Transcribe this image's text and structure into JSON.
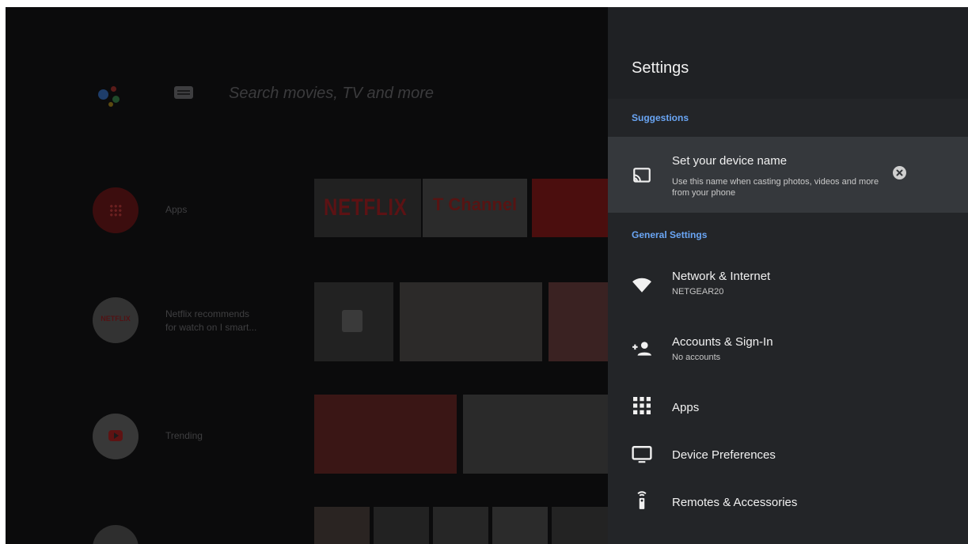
{
  "home": {
    "search_placeholder": "Search movies, TV and more",
    "rows": [
      {
        "label": "Apps"
      },
      {
        "label": "Netflix recommends",
        "label2": "for watch on I smart..."
      },
      {
        "label": "Trending"
      }
    ],
    "netflix_tile": "NETFLIX",
    "channel_tile": "T Channel",
    "netflix_badge": "NETFLIX"
  },
  "settings": {
    "title": "Settings",
    "suggestions_label": "Suggestions",
    "suggestion": {
      "title": "Set your device name",
      "subtitle": "Use this name when casting photos, videos and more from your phone",
      "icon": "cast-icon"
    },
    "general_label": "General Settings",
    "items": [
      {
        "title": "Network & Internet",
        "subtitle": "NETGEAR20",
        "icon": "wifi-icon"
      },
      {
        "title": "Accounts & Sign-In",
        "subtitle": "No accounts",
        "icon": "add-person-icon"
      },
      {
        "title": "Apps",
        "subtitle": "",
        "icon": "apps-grid-icon"
      },
      {
        "title": "Device Preferences",
        "subtitle": "",
        "icon": "tv-icon"
      },
      {
        "title": "Remotes & Accessories",
        "subtitle": "",
        "icon": "remote-icon"
      }
    ]
  },
  "colors": {
    "accent": "#6aa6f5",
    "panel": "#232528",
    "highlight": "#35383c",
    "text": "#f1f1f1"
  }
}
